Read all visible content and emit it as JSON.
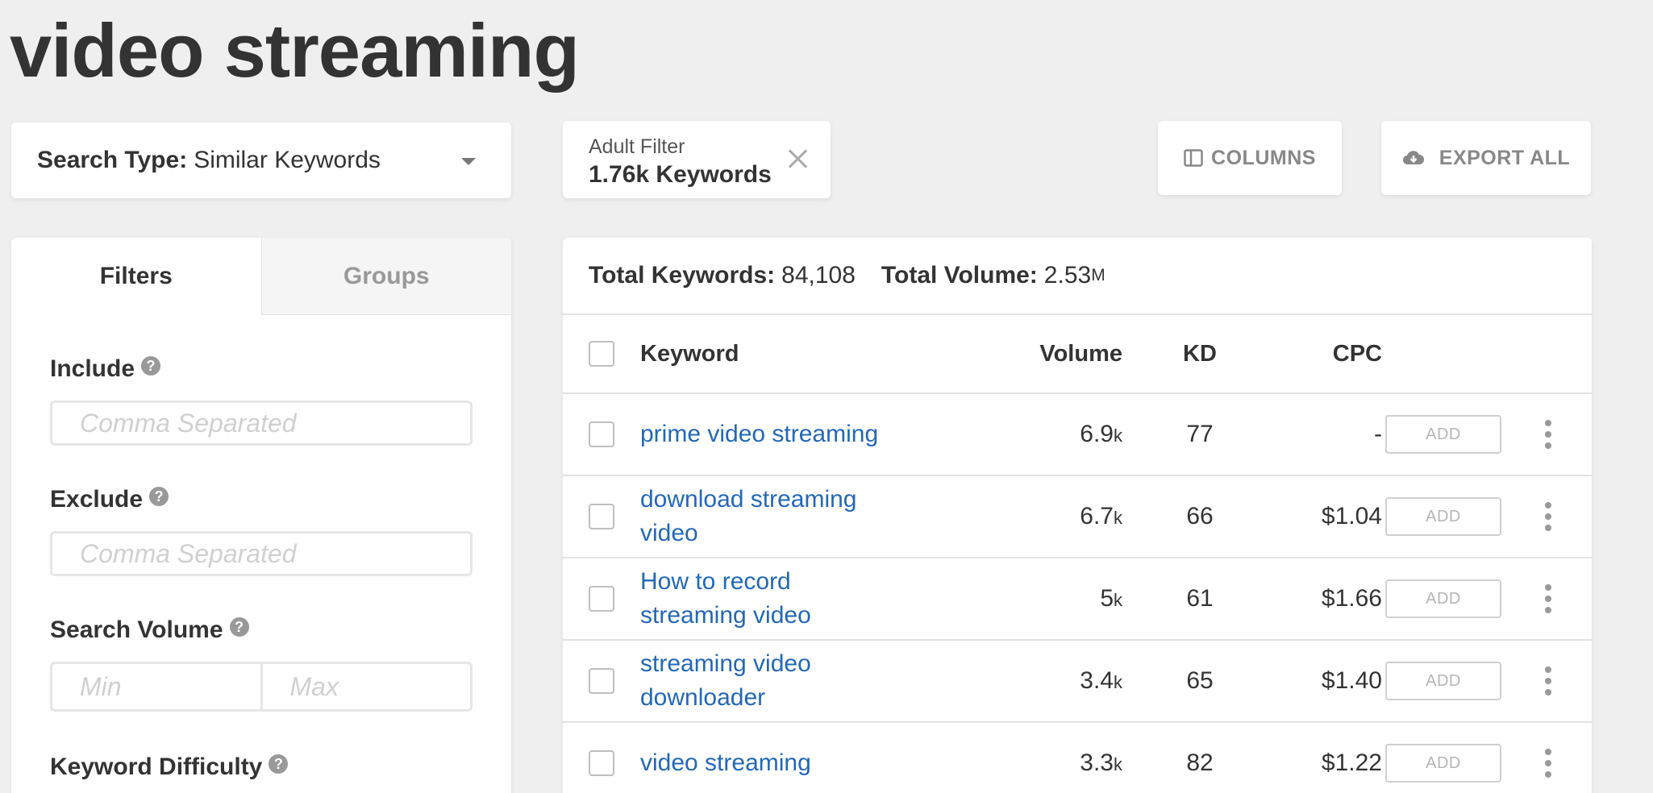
{
  "page": {
    "title": "video streaming"
  },
  "search_type": {
    "label": "Search Type:",
    "value": "Similar Keywords"
  },
  "adult_filter": {
    "label": "Adult Filter",
    "value": "1.76k Keywords"
  },
  "toolbar": {
    "columns_label": "COLUMNS",
    "export_label": "EXPORT ALL"
  },
  "sidebar": {
    "tabs": [
      {
        "label": "Filters"
      },
      {
        "label": "Groups"
      }
    ],
    "include": {
      "label": "Include",
      "placeholder": "Comma Separated"
    },
    "exclude": {
      "label": "Exclude",
      "placeholder": "Comma Separated"
    },
    "search_volume": {
      "label": "Search Volume",
      "min_placeholder": "Min",
      "max_placeholder": "Max"
    },
    "keyword_difficulty": {
      "label": "Keyword Difficulty"
    },
    "help_glyph": "?"
  },
  "totals": {
    "keywords_label": "Total Keywords:",
    "keywords_value": "84,108",
    "volume_label": "Total Volume:",
    "volume_value": "2.53",
    "volume_unit": "M"
  },
  "table": {
    "headers": {
      "keyword": "Keyword",
      "volume": "Volume",
      "kd": "KD",
      "cpc": "CPC"
    },
    "add_label": "ADD",
    "rows": [
      {
        "keyword_line1": "prime video streaming",
        "keyword_line2": "",
        "volume": "6.9",
        "unit": "k",
        "kd": "77",
        "cpc": "-"
      },
      {
        "keyword_line1": "download streaming",
        "keyword_line2": "video",
        "volume": "6.7",
        "unit": "k",
        "kd": "66",
        "cpc": "$1.04"
      },
      {
        "keyword_line1": "How to record",
        "keyword_line2": "streaming video",
        "volume": "5",
        "unit": "k",
        "kd": "61",
        "cpc": "$1.66"
      },
      {
        "keyword_line1": "streaming video",
        "keyword_line2": "downloader",
        "volume": "3.4",
        "unit": "k",
        "kd": "65",
        "cpc": "$1.40"
      },
      {
        "keyword_line1": "video streaming",
        "keyword_line2": "",
        "volume": "3.3",
        "unit": "k",
        "kd": "82",
        "cpc": "$1.22"
      }
    ]
  },
  "icons": {
    "columns": "columns-icon",
    "export": "cloud-download-icon",
    "close": "close-icon",
    "caret": "caret-down-icon",
    "more": "more-vertical-icon"
  },
  "colors": {
    "link": "#2268b8",
    "background": "#efefef"
  }
}
